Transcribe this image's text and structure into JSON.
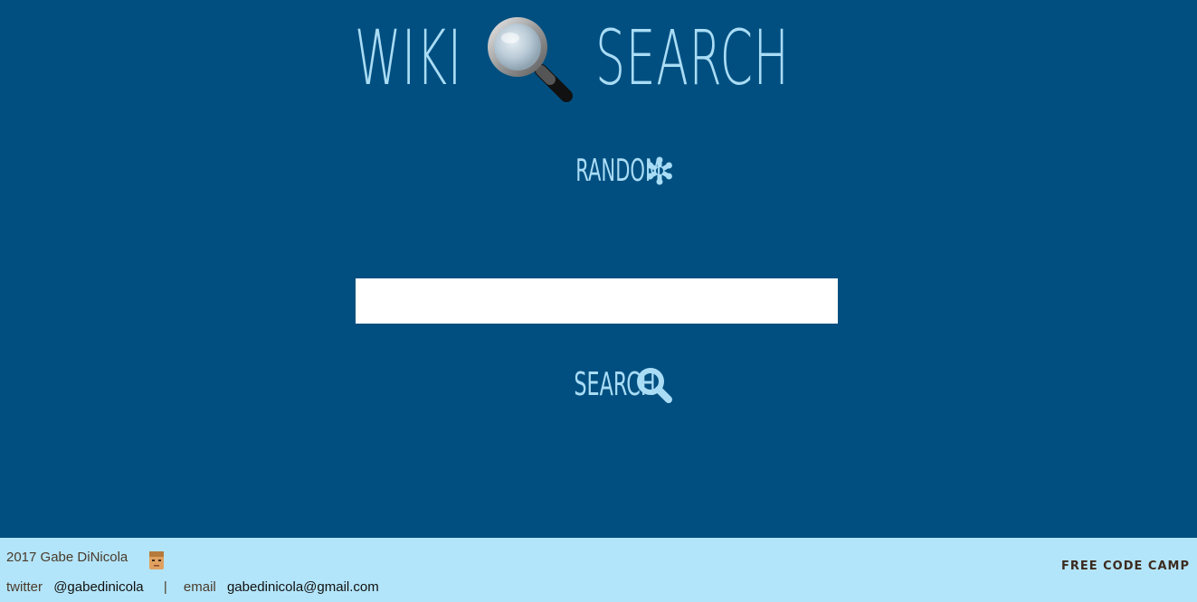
{
  "header": {
    "title_left": "WIKI",
    "title_icon": "magnifying-glass-emoji",
    "title_right": "SEARCH"
  },
  "random": {
    "label": "RANDOM",
    "icon": "asterisk-flake-icon"
  },
  "search": {
    "input_value": "",
    "placeholder": "",
    "button_label": "SEARCH",
    "button_icon": "search-icon"
  },
  "footer": {
    "credit": "2017 Gabe DiNicola",
    "avatar_icon": "avatar-icon",
    "twitter_label": "twitter",
    "twitter_handle": "@gabedinicola",
    "separator": "|",
    "email_label": "email",
    "email_value": "gabedinicola@gmail.com",
    "brand": "FREE CODE CAMP"
  },
  "colors": {
    "background": "#004f80",
    "accent": "#a9dcf5",
    "footer_bg": "#b3e5fa",
    "brand_text": "#3d2b1f"
  }
}
